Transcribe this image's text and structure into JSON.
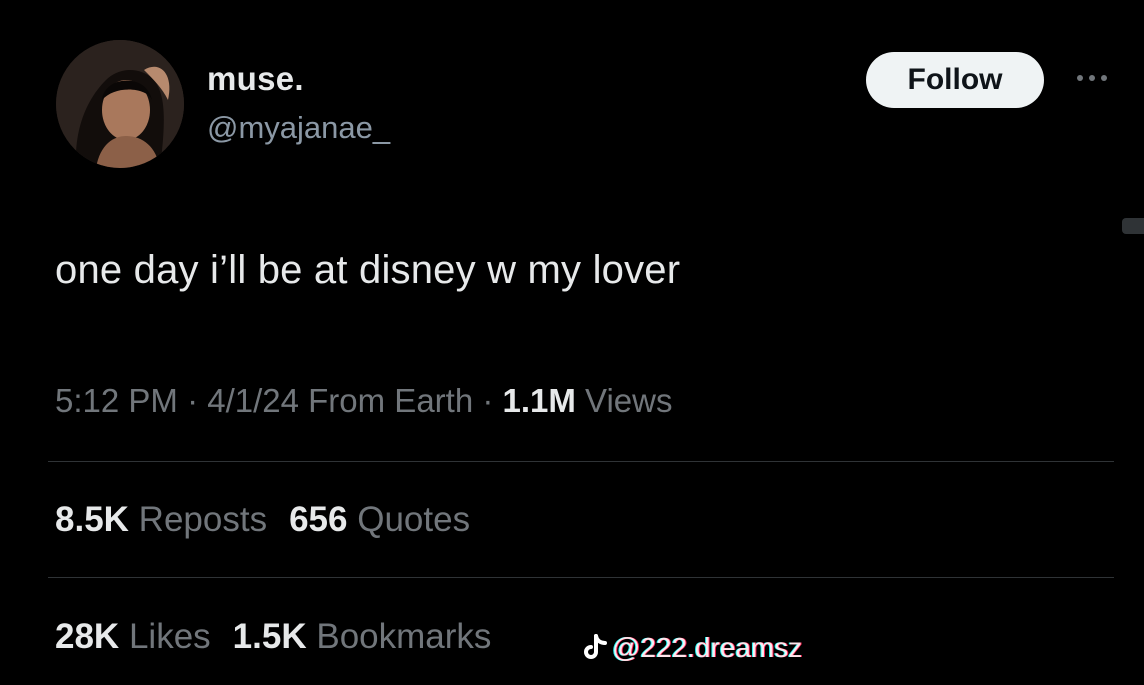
{
  "profile": {
    "display_name": "muse.",
    "handle": "@myajanae_"
  },
  "follow_button": {
    "label": "Follow"
  },
  "tweet": {
    "text": "one day i’ll be at disney w my lover"
  },
  "meta": {
    "time": "5:12 PM",
    "sep1": " · ",
    "date": "4/1/24",
    "source": " From Earth",
    "sep2": " · ",
    "views_count": "1.1M",
    "views_label": " Views"
  },
  "stats": {
    "reposts_count": "8.5K",
    "reposts_label": "Reposts",
    "quotes_count": "656",
    "quotes_label": "Quotes",
    "likes_count": "28K",
    "likes_label": "Likes",
    "bookmarks_count": "1.5K",
    "bookmarks_label": "Bookmarks"
  },
  "watermark": {
    "icon": "tiktok-icon",
    "text": "@222.dreamsz"
  },
  "colors": {
    "background": "#000000",
    "primary_text": "#e7e9ea",
    "secondary_text": "#71767b",
    "follow_bg": "#eff3f4",
    "divider": "#2f3336"
  }
}
